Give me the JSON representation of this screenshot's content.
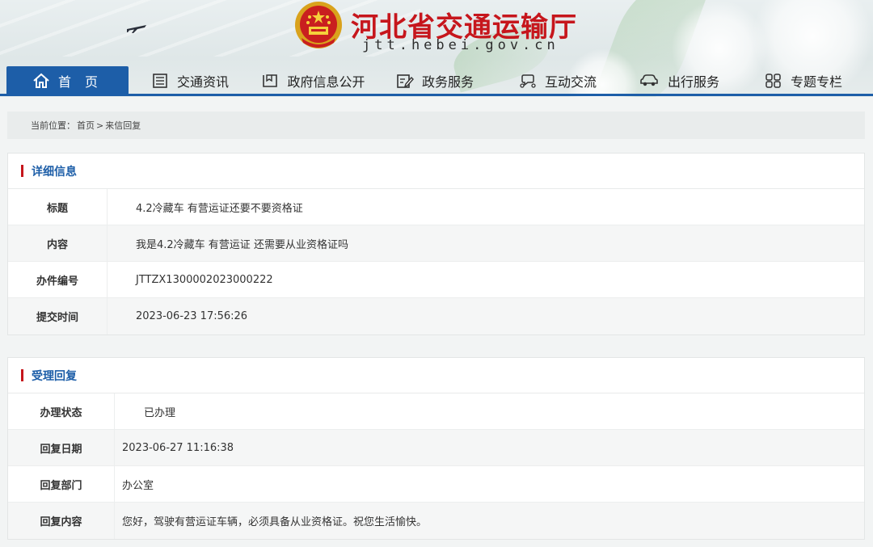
{
  "header": {
    "site_title": "河北省交通运输厅",
    "site_url": "jtt.hebei.gov.cn"
  },
  "nav": {
    "items": [
      {
        "label": "首 页",
        "icon": "home-icon",
        "active": true
      },
      {
        "label": "交通资讯",
        "icon": "newspaper-icon"
      },
      {
        "label": "政府信息公开",
        "icon": "document-icon"
      },
      {
        "label": "政务服务",
        "icon": "edit-icon"
      },
      {
        "label": "互动交流",
        "icon": "chat-icon"
      },
      {
        "label": "出行服务",
        "icon": "car-icon"
      },
      {
        "label": "专题专栏",
        "icon": "grid-icon"
      }
    ],
    "accent_color": "#1d5ea8"
  },
  "breadcrumb": {
    "prefix": "当前位置：",
    "home": "首页",
    "separator": ">",
    "current": "来信回复"
  },
  "detail": {
    "section_title": "详细信息",
    "rows": [
      {
        "label": "标题",
        "value": "4.2冷藏车 有营运证还要不要资格证"
      },
      {
        "label": "内容",
        "value": "我是4.2冷藏车 有营运证 还需要从业资格证吗"
      },
      {
        "label": "办件编号",
        "value": "JTTZX1300002023000222"
      },
      {
        "label": "提交时间",
        "value": "2023-06-23 17:56:26"
      }
    ]
  },
  "reply": {
    "section_title": "受理回复",
    "rows": [
      {
        "label": "办理状态",
        "value": "已办理",
        "status_color": "#2e8b2e"
      },
      {
        "label": "回复日期",
        "value": "2023-06-27 11:16:38"
      },
      {
        "label": "回复部门",
        "value": "办公室"
      },
      {
        "label": "回复内容",
        "value": "您好，驾驶有营运证车辆，必须具备从业资格证。祝您生活愉快。"
      }
    ]
  },
  "colors": {
    "title_red": "#c6161c",
    "section_title_blue": "#1d5ea8"
  }
}
